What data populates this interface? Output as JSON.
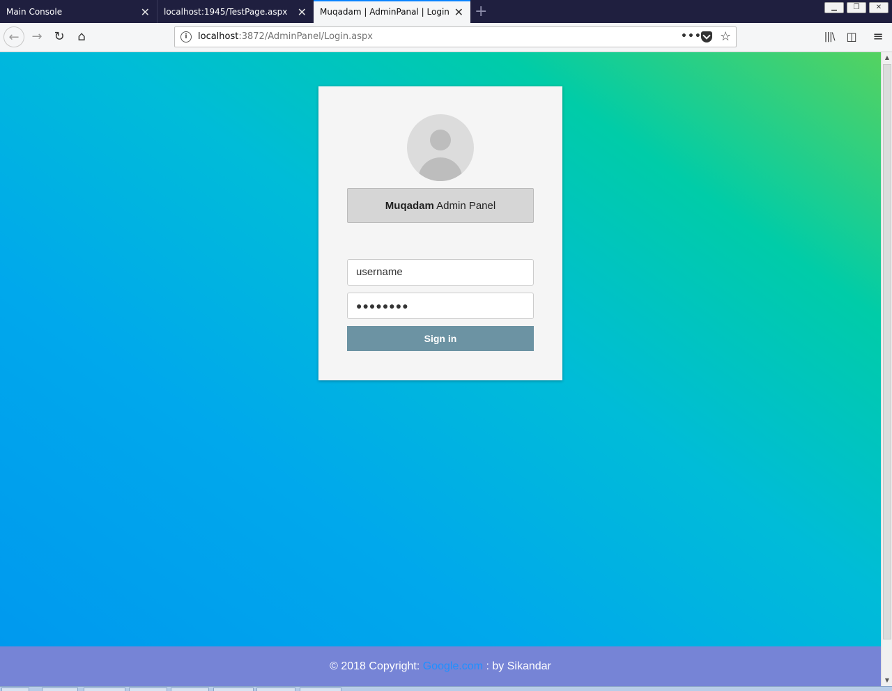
{
  "browser": {
    "tabs": [
      {
        "label": "Main Console"
      },
      {
        "label": "localhost:1945/TestPage.aspx"
      },
      {
        "label": "Muqadam | AdminPanal | Login"
      }
    ],
    "url_host": "localhost",
    "url_rest": ":3872/AdminPanel/Login.aspx"
  },
  "login": {
    "title_bold": "Muqadam",
    "title_rest": " Admin Panel",
    "username_placeholder": "username",
    "password_mask": "●●●●●●●●",
    "signin_label": "Sign in"
  },
  "footer": {
    "prefix": "© 2018 Copyright: ",
    "link": "Google.com",
    "suffix": " : by Sikandar"
  },
  "colors": {
    "signin_button": "#6c93a3",
    "footer_bg": "#7684d6",
    "footer_link": "#1e90ff"
  }
}
